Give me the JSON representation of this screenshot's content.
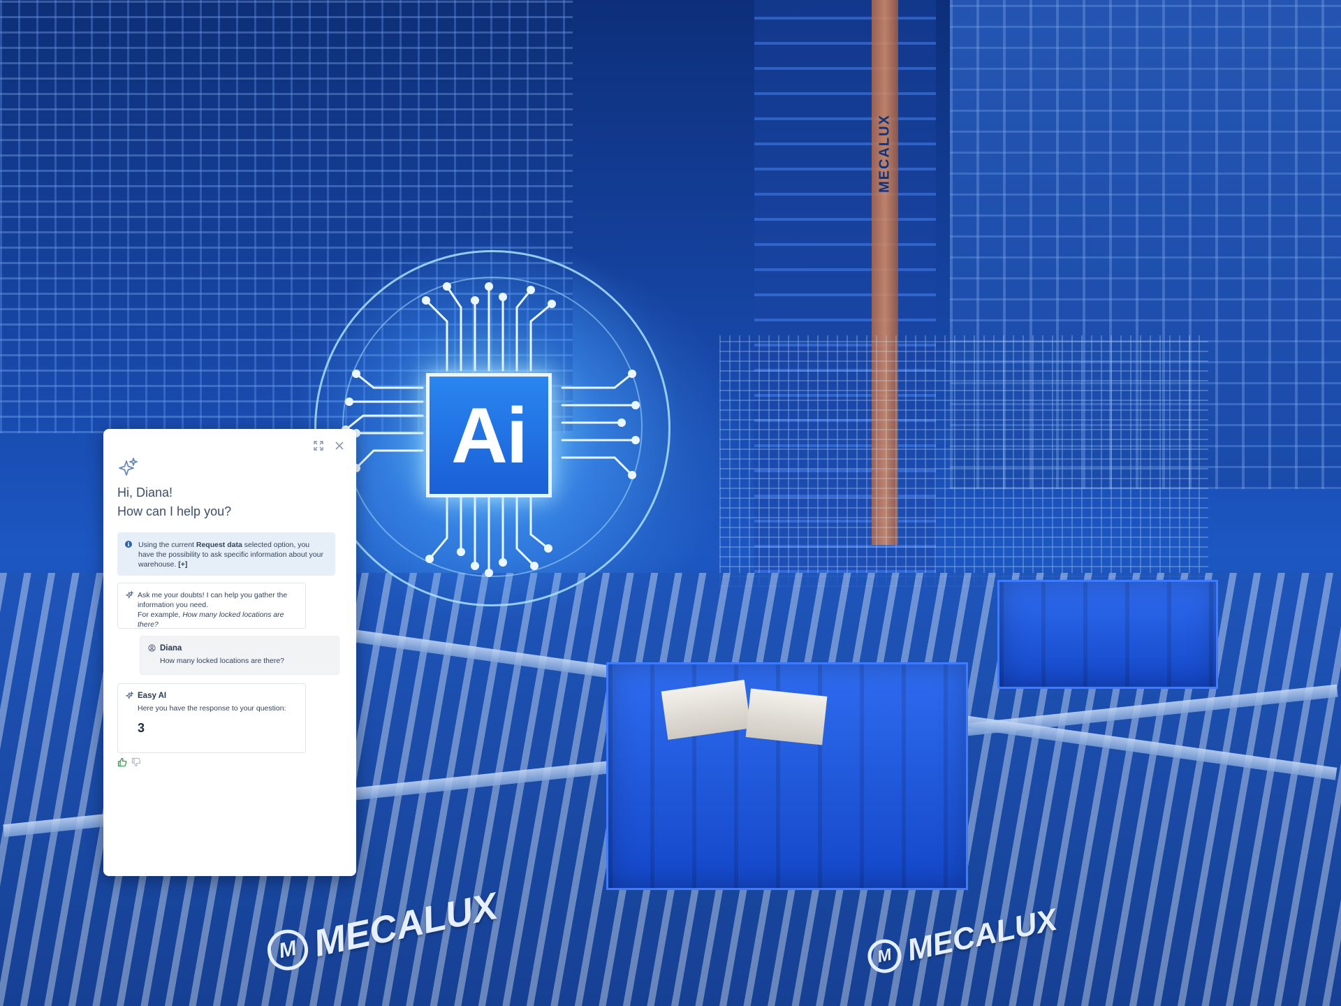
{
  "background": {
    "brand": "MECALUX",
    "colors": {
      "scene": "#1747a8",
      "accent": "#2a86f0",
      "glow": "#78d2ff"
    }
  },
  "ai_badge": {
    "label": "Ai"
  },
  "chat": {
    "greeting_line1": "Hi, Diana!",
    "greeting_line2": "How can I help you?",
    "info": {
      "prefix": "Using the current ",
      "bold": "Request data",
      "suffix": " selected option, you have the possibility to ask specific information about your warehouse. ",
      "expand": "[+]"
    },
    "bot_intro": {
      "line1": "Ask me your doubts! I can help you gather the information you need.",
      "example_prefix": "For example, ",
      "example": "How many locked locations are there?"
    },
    "user_message": {
      "sender": "Diana",
      "text": "How many locked locations are there?"
    },
    "bot_answer": {
      "sender": "Easy AI",
      "text": "Here you have the response to your question:",
      "value": "3"
    }
  },
  "icons": {
    "expand": "expand-icon",
    "close": "close-icon",
    "sparkle": "sparkle-icon",
    "info": "info-icon",
    "bot": "sparkle-icon",
    "user": "user-icon",
    "like": "thumbs-up-icon",
    "dislike": "thumbs-down-icon"
  }
}
